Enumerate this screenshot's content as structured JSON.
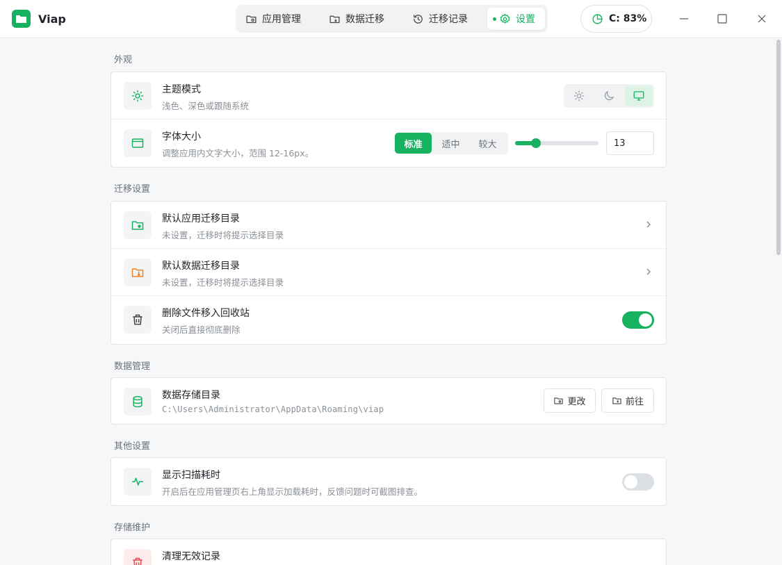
{
  "app": {
    "name": "Viap"
  },
  "nav": {
    "tabs": [
      {
        "label": "应用管理",
        "icon": "folder-cog-icon",
        "active": false
      },
      {
        "label": "数据迁移",
        "icon": "folder-sync-icon",
        "active": false
      },
      {
        "label": "迁移记录",
        "icon": "history-icon",
        "active": false
      },
      {
        "label": "设置",
        "icon": "gear-icon",
        "active": true
      }
    ]
  },
  "disk": {
    "label": "C: 83%",
    "percent": 83
  },
  "colors": {
    "accent": "#17b260",
    "warning": "#e8852a",
    "danger": "#e5484d"
  },
  "sections": {
    "appearance": {
      "title": "外观",
      "theme": {
        "title": "主题模式",
        "desc": "浅色、深色或跟随系统",
        "selected": "system",
        "options": [
          "light",
          "dark",
          "system"
        ]
      },
      "font": {
        "title": "字体大小",
        "desc": "调整应用内文字大小，范围 12-16px。",
        "presets": [
          "标准",
          "适中",
          "较大"
        ],
        "selected_preset": "标准",
        "value": "13",
        "min": 12,
        "max": 16,
        "numeric_value": 13
      }
    },
    "migration": {
      "title": "迁移设置",
      "app_dir": {
        "title": "默认应用迁移目录",
        "desc": "未设置，迁移时将提示选择目录"
      },
      "data_dir": {
        "title": "默认数据迁移目录",
        "desc": "未设置，迁移时将提示选择目录"
      },
      "recycle": {
        "title": "删除文件移入回收站",
        "desc": "关闭后直接彻底删除",
        "enabled": true
      }
    },
    "data": {
      "title": "数据管理",
      "storage": {
        "title": "数据存储目录",
        "path": "C:\\Users\\Administrator\\AppData\\Roaming\\viap",
        "change_label": "更改",
        "open_label": "前往"
      }
    },
    "other": {
      "title": "其他设置",
      "scan_time": {
        "title": "显示扫描耗时",
        "desc": "开启后在应用管理页右上角显示加载耗时，反馈问题时可截图排查。",
        "enabled": false
      }
    },
    "maintenance": {
      "title": "存储维护",
      "cleanup": {
        "title": "清理无效记录"
      }
    }
  }
}
